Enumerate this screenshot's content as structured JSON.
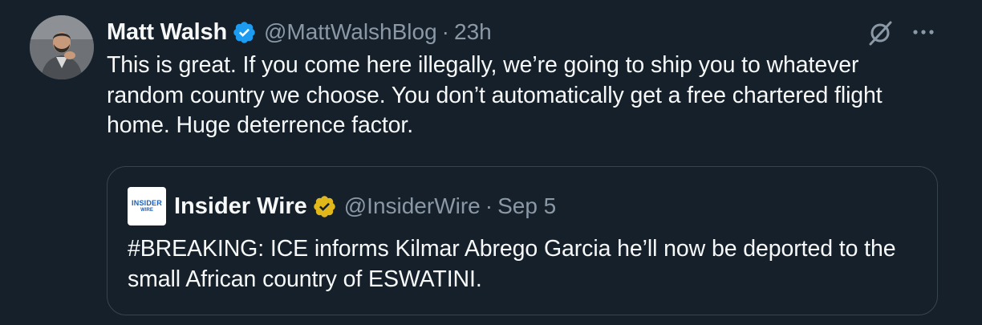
{
  "colors": {
    "background": "#15202b",
    "primary_text": "#f7f9f9",
    "secondary_text": "#8b98a5",
    "verified_blue": "#1d9bf0",
    "verified_gold": "#e2b719",
    "border": "#38444d"
  },
  "tweet": {
    "author_name": "Matt Walsh",
    "handle": "@MattWalshBlog",
    "separator": "·",
    "time": "23h",
    "verified_badge": "blue-check-icon",
    "text": "This is great. If you come here illegally, we’re going to ship you to whatever random country we choose. You don’t automatically get a free chartered flight home. Huge deterrence factor.",
    "actions": {
      "grok_icon": "grok-slash-icon",
      "more_icon": "more-horizontal-icon"
    }
  },
  "quoted_tweet": {
    "author_name": "Insider Wire",
    "handle": "@InsiderWire",
    "separator": "·",
    "time": "Sep 5",
    "verified_badge": "gold-check-icon",
    "logo_text_line1": "INSIDER",
    "logo_text_line2": "WIRE",
    "text": "#BREAKING: ICE informs Kilmar Abrego Garcia he’ll now be deported to the small African country of ESWATINI."
  }
}
